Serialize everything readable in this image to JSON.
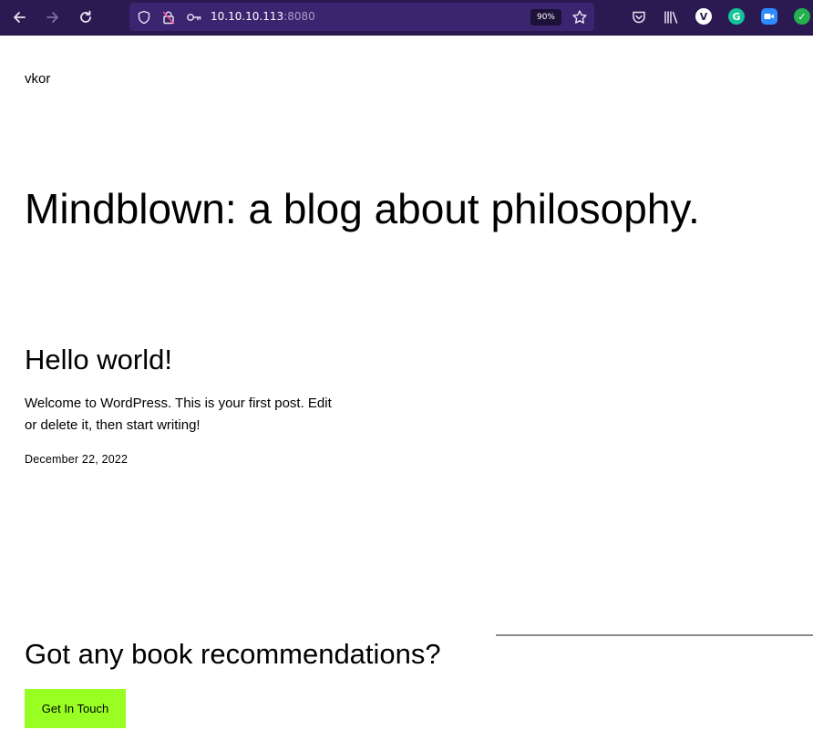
{
  "browser": {
    "url_host": "10.10.10.113",
    "url_port": ":8080",
    "zoom": "90%",
    "icons": {
      "back": "back-arrow-icon",
      "forward": "forward-arrow-icon",
      "reload": "reload-icon",
      "shield": "tracking-shield-icon",
      "permissions": "permissions-icon",
      "key": "key-icon",
      "bookmark": "bookmark-star-icon",
      "pocket": "pocket-icon",
      "library": "library-icon"
    },
    "extensions": [
      {
        "name": "vimium-extension-icon",
        "letter": "V",
        "color": "#ffffff",
        "text_color": "#2b1a52"
      },
      {
        "name": "grammarly-extension-icon",
        "letter": "G",
        "color": "#15c39a",
        "text_color": "#ffffff"
      },
      {
        "name": "zoom-extension-icon",
        "letter": "",
        "color": "#2d8cff",
        "text_color": "#ffffff"
      },
      {
        "name": "check-extension-icon",
        "letter": "✓",
        "color": "#22b14c",
        "text_color": "#ffffff"
      }
    ],
    "colors": {
      "toolbar": "#2b1a52",
      "urlbar": "#3b2470"
    }
  },
  "site": {
    "title": "vkor",
    "tagline": "Mindblown: a blog about philosophy."
  },
  "post": {
    "title": "Hello world!",
    "excerpt": "Welcome to WordPress. This is your first post. Edit or delete it, then start writing!",
    "date": "December 22, 2022"
  },
  "cta": {
    "heading": "Got any book recommendations?",
    "button_label": "Get In Touch",
    "button_color": "#99ff22"
  }
}
